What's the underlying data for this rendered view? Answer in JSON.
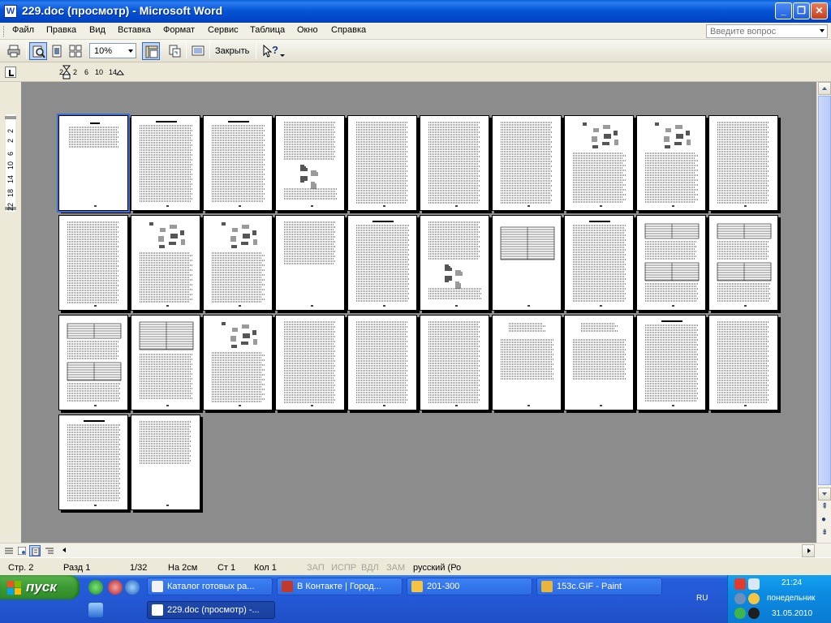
{
  "window": {
    "title": "229.doc (просмотр) - Microsoft Word",
    "app_icon_letter": "W",
    "min_glyph": "_",
    "max_glyph": "❐",
    "close_glyph": "✕"
  },
  "menu": {
    "items": [
      "Файл",
      "Правка",
      "Вид",
      "Вставка",
      "Формат",
      "Сервис",
      "Таблица",
      "Окно",
      "Справка"
    ],
    "question_placeholder": "Введите вопрос"
  },
  "toolbar": {
    "zoom": "10%",
    "close_label": "Закрыть",
    "help_glyph": "?"
  },
  "ruler": {
    "h_labels": [
      "2",
      "2",
      "6",
      "10",
      "14"
    ],
    "v_labels": [
      "2",
      "2",
      "6",
      "10",
      "14",
      "18",
      "22"
    ]
  },
  "document": {
    "pages": [
      {
        "type": "title"
      },
      {
        "type": "heading_text"
      },
      {
        "type": "heading_text"
      },
      {
        "type": "text_image"
      },
      {
        "type": "text"
      },
      {
        "type": "text"
      },
      {
        "type": "text"
      },
      {
        "type": "image_text"
      },
      {
        "type": "image_text"
      },
      {
        "type": "text"
      },
      {
        "type": "text"
      },
      {
        "type": "image_text"
      },
      {
        "type": "image_text"
      },
      {
        "type": "text_short"
      },
      {
        "type": "heading_text"
      },
      {
        "type": "text_image"
      },
      {
        "type": "table"
      },
      {
        "type": "heading_text"
      },
      {
        "type": "tables"
      },
      {
        "type": "tables"
      },
      {
        "type": "tables"
      },
      {
        "type": "table_text"
      },
      {
        "type": "image_text"
      },
      {
        "type": "text"
      },
      {
        "type": "text"
      },
      {
        "type": "text"
      },
      {
        "type": "sparse"
      },
      {
        "type": "sparse"
      },
      {
        "type": "heading_text"
      },
      {
        "type": "text"
      },
      {
        "type": "heading_text"
      },
      {
        "type": "text_short"
      }
    ],
    "active_page_index": 0
  },
  "status": {
    "page": "Стр. 2",
    "section": "Разд 1",
    "of_pages": "1/32",
    "at": "На 2см",
    "line": "Ст 1",
    "col": "Кол 1",
    "rec": "ЗАП",
    "trk": "ИСПР",
    "ext": "ВДЛ",
    "ovr": "ЗАМ",
    "language": "русский (Ро"
  },
  "taskbar": {
    "start_label": "пуск",
    "tasks": [
      {
        "label": "Каталог готовых ра...",
        "icon_color": "#F2F2F2"
      },
      {
        "label": "В Контакте | Город...",
        "icon_color": "#C0392B"
      },
      {
        "label": "201-300",
        "icon_color": "#F4C542"
      },
      {
        "label": "153c.GIF - Paint",
        "icon_color": "#E9B53B"
      },
      {
        "label": "229.doc (просмотр) -...",
        "icon_color": "#FFFFFF"
      }
    ],
    "lang": "RU",
    "time": "21:24",
    "day": "понедельник",
    "date": "31.05.2010"
  }
}
